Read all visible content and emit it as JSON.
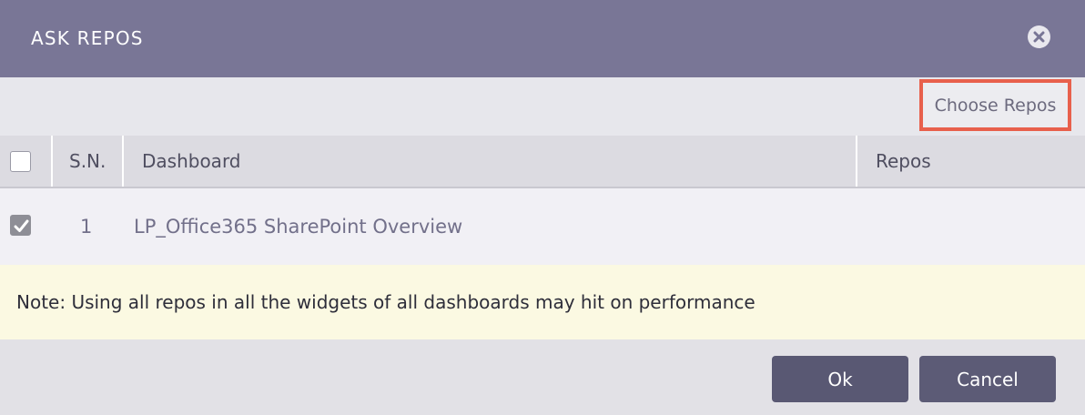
{
  "dialog": {
    "title": "ASK REPOS",
    "close_icon": "close-circle-icon"
  },
  "toolbar": {
    "choose_repos_label": "Choose Repos",
    "highlight_color": "#e8604c"
  },
  "table": {
    "columns": [
      "S.N.",
      "Dashboard",
      "Repos"
    ],
    "select_all_checked": false,
    "rows": [
      {
        "checked": true,
        "sn": "1",
        "dashboard": "LP_Office365 SharePoint Overview",
        "repos": ""
      }
    ]
  },
  "note": {
    "text": "Note: Using all repos in all the widgets of all dashboards may hit on performance"
  },
  "footer": {
    "ok_label": "Ok",
    "cancel_label": "Cancel"
  },
  "colors": {
    "titlebar": "#797696",
    "button": "#595873",
    "note_background": "#fbf9e2"
  }
}
